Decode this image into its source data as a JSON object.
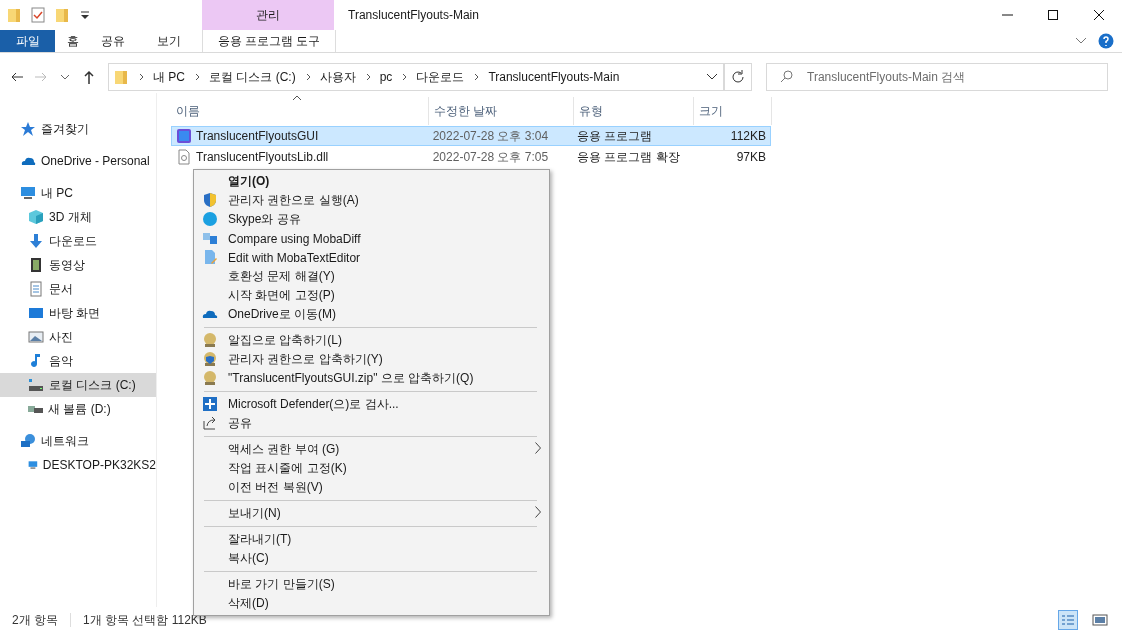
{
  "window": {
    "title": "TranslucentFlyouts-Main",
    "context_group": "관리"
  },
  "ribbon": {
    "tabs": [
      {
        "label": "파일",
        "selected": true
      },
      {
        "label": "홈",
        "selected": false
      },
      {
        "label": "공유",
        "selected": false
      },
      {
        "label": "보기",
        "selected": false
      }
    ],
    "context_tab": "응용 프로그램 도구"
  },
  "address": {
    "crumbs": [
      "내 PC",
      "로컬 디스크 (C:)",
      "사용자",
      "pc",
      "다운로드",
      "TranslucentFlyouts-Main"
    ]
  },
  "search": {
    "placeholder": "TranslucentFlyouts-Main 검색"
  },
  "sidebar": {
    "items": [
      {
        "label": "즐겨찾기",
        "selected": false
      },
      {
        "label": "OneDrive - Personal",
        "selected": false
      },
      {
        "label": "내 PC",
        "selected": false,
        "children": [
          {
            "label": "3D 개체",
            "selected": false
          },
          {
            "label": "다운로드",
            "selected": false
          },
          {
            "label": "동영상",
            "selected": false
          },
          {
            "label": "문서",
            "selected": false
          },
          {
            "label": "바탕 화면",
            "selected": false
          },
          {
            "label": "사진",
            "selected": false
          },
          {
            "label": "음악",
            "selected": false
          },
          {
            "label": "로컬 디스크 (C:)",
            "selected": true
          },
          {
            "label": "새 볼륨 (D:)",
            "selected": false
          }
        ]
      },
      {
        "label": "네트워크",
        "selected": false,
        "children": [
          {
            "label": "DESKTOP-PK32KS2",
            "selected": false
          }
        ]
      }
    ]
  },
  "table": {
    "columns": [
      "이름",
      "수정한 날짜",
      "유형",
      "크기"
    ],
    "rows": [
      {
        "cells": [
          "TranslucentFlyoutsGUI",
          "2022-07-28 오후 3:04",
          "응용 프로그램",
          "112KB"
        ],
        "selected": true
      },
      {
        "cells": [
          "TranslucentFlyoutsLib.dll",
          "2022-07-28 오후 7:05",
          "응용 프로그램 확장",
          "97KB"
        ],
        "selected": false
      }
    ]
  },
  "context_menu": {
    "items": [
      {
        "kind": "item",
        "label": "열기(O)",
        "default": true,
        "submenu": false
      },
      {
        "kind": "item",
        "label": "관리자 권한으로 실행(A)",
        "default": false,
        "submenu": false
      },
      {
        "kind": "item",
        "label": "Skype와 공유",
        "default": false,
        "submenu": false
      },
      {
        "kind": "item",
        "label": "Compare using MobaDiff",
        "default": false,
        "submenu": false
      },
      {
        "kind": "item",
        "label": "Edit with MobaTextEditor",
        "default": false,
        "submenu": false
      },
      {
        "kind": "item",
        "label": "호환성 문제 해결(Y)",
        "default": false,
        "submenu": false
      },
      {
        "kind": "item",
        "label": "시작 화면에 고정(P)",
        "default": false,
        "submenu": false
      },
      {
        "kind": "item",
        "label": "OneDrive로 이동(M)",
        "default": false,
        "submenu": false
      },
      {
        "kind": "separator"
      },
      {
        "kind": "item",
        "label": "알집으로 압축하기(L)",
        "default": false,
        "submenu": false
      },
      {
        "kind": "item",
        "label": "관리자 권한으로 압축하기(Y)",
        "default": false,
        "submenu": false
      },
      {
        "kind": "item",
        "label": "\"TranslucentFlyoutsGUI.zip\" 으로 압축하기(Q)",
        "default": false,
        "submenu": false
      },
      {
        "kind": "separator"
      },
      {
        "kind": "item",
        "label": "Microsoft Defender(으)로 검사...",
        "default": false,
        "submenu": false
      },
      {
        "kind": "item",
        "label": "공유",
        "default": false,
        "submenu": false
      },
      {
        "kind": "separator"
      },
      {
        "kind": "item",
        "label": "액세스 권한 부여 (G)",
        "default": false,
        "submenu": true
      },
      {
        "kind": "item",
        "label": "작업 표시줄에 고정(K)",
        "default": false,
        "submenu": false
      },
      {
        "kind": "item",
        "label": "이전 버전 복원(V)",
        "default": false,
        "submenu": false
      },
      {
        "kind": "separator"
      },
      {
        "kind": "item",
        "label": "보내기(N)",
        "default": false,
        "submenu": true
      },
      {
        "kind": "separator"
      },
      {
        "kind": "item",
        "label": "잘라내기(T)",
        "default": false,
        "submenu": false
      },
      {
        "kind": "item",
        "label": "복사(C)",
        "default": false,
        "submenu": false
      },
      {
        "kind": "separator"
      },
      {
        "kind": "item",
        "label": "바로 가기 만들기(S)",
        "default": false,
        "submenu": false
      },
      {
        "kind": "item",
        "label": "삭제(D)",
        "default": false,
        "submenu": false
      }
    ]
  },
  "status_bar": {
    "count": "2개 항목",
    "selection": "1개 항목 선택함 112KB",
    "views": [
      {
        "selected": true
      },
      {
        "selected": false
      }
    ]
  }
}
